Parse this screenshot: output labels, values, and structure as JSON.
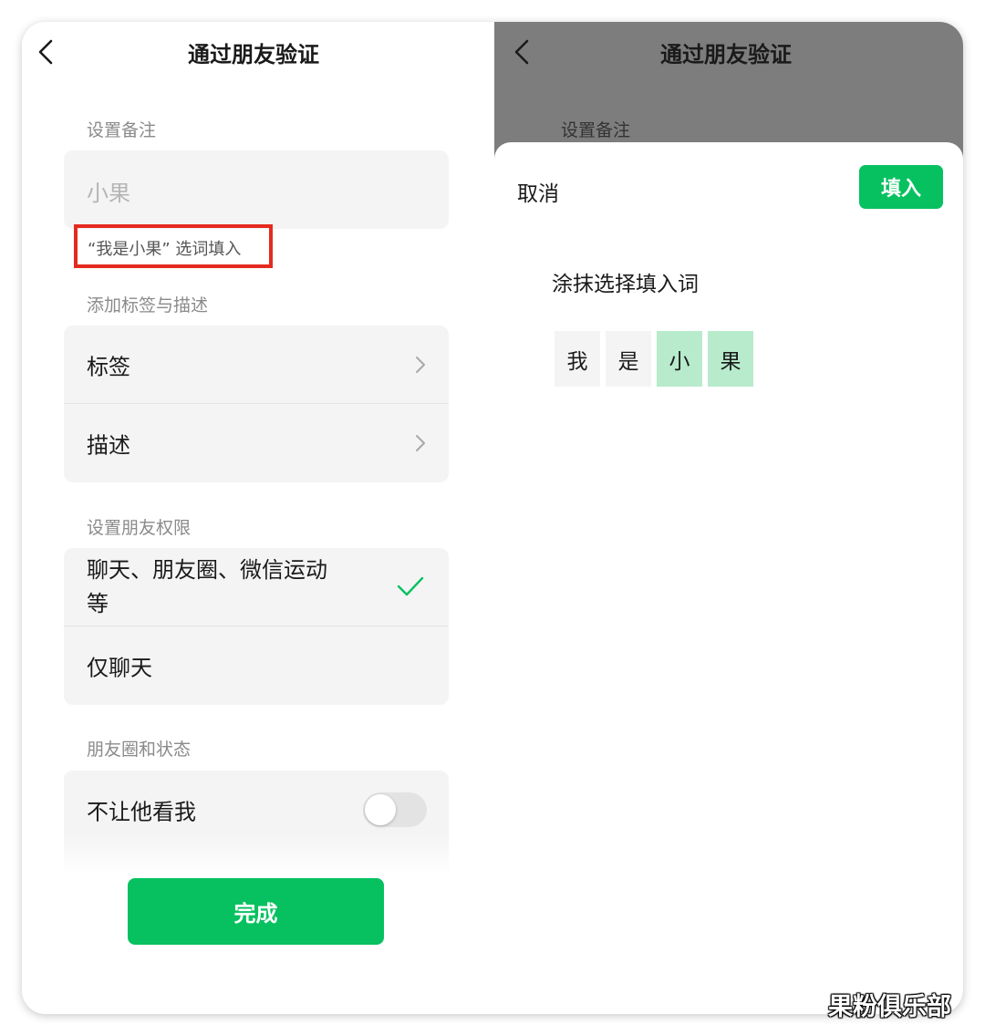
{
  "left": {
    "title": "通过朋友验证",
    "remark_section_label": "设置备注",
    "remark_input_value": "小果",
    "suggestion_text": "“我是小果” 选词填入",
    "tags_section_label": "添加标签与描述",
    "tag_rows": [
      {
        "label": "标签"
      },
      {
        "label": "描述"
      }
    ],
    "permission_section_label": "设置朋友权限",
    "permission_options": [
      {
        "label_line1": "聊天、朋友圈、微信运动",
        "label_line2": "等",
        "selected": true
      },
      {
        "label": "仅聊天",
        "selected": false
      }
    ],
    "moments_section_label": "朋友圈和状态",
    "moments_rows": [
      {
        "label": "不让他看我",
        "toggle_on": false
      }
    ],
    "done_label": "完成"
  },
  "right": {
    "title": "通过朋友验证",
    "remark_section_label": "设置备注",
    "cancel_label": "取消",
    "fill_label": "填入",
    "hint": "涂抹选择填入词",
    "characters": [
      {
        "char": "我",
        "selected": false
      },
      {
        "char": "是",
        "selected": false
      },
      {
        "char": "小",
        "selected": true
      },
      {
        "char": "果",
        "selected": true
      }
    ]
  },
  "watermark": "果粉俱乐部",
  "colors": {
    "accent_green": "#07c160",
    "selected_char_bg": "#b7ebcc",
    "highlight_border": "#e52a1f",
    "overlay_gray": "#7d7d7d"
  }
}
